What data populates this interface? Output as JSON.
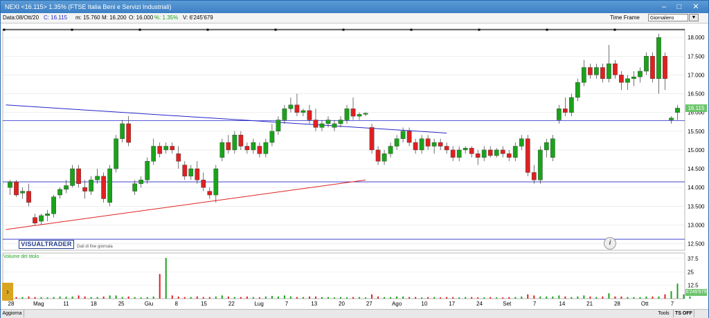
{
  "window": {
    "title": "NEXI <16.115> 1.35%  (FTSE Italia Beni e Servizi Industriali)",
    "buttons": {
      "minimize": "–",
      "maximize": "□",
      "close": "✕"
    }
  },
  "infobar": {
    "date": "Data:08/Ott/20",
    "close_label": "C: 16.115",
    "min_label": "m: 15.760",
    "max_label": "M: 16.200",
    "open_label": "O: 16.000",
    "pct_label": "%: 1.35%",
    "vol_label": "V: 6'245'679"
  },
  "timeframe": {
    "label": "Time Frame",
    "selected": "Giornaliero"
  },
  "logo": "VISUALTRADER",
  "eod_note": "Dati di fine giornata",
  "volume_title": "Volume del titolo",
  "price_badge": "16.115",
  "vol_badge": "6'245'679",
  "bottombar": {
    "update": "Aggiorna",
    "tools": "Tools",
    "ts": "TS OFF"
  },
  "colors": {
    "up": "#1aa31a",
    "down": "#e02020",
    "line_blue": "#2424c8",
    "line_red": "#e02020"
  },
  "chart_data": {
    "type": "candlestick",
    "y_ticks": [
      "18.000",
      "17.500",
      "17.000",
      "16.500",
      "16.000",
      "15.500",
      "15.000",
      "14.500",
      "14.000",
      "13.500",
      "13.000",
      "12.500"
    ],
    "y_range": [
      12.4,
      18.15
    ],
    "vol_ticks": [
      "37.5",
      "25",
      "12.5"
    ],
    "vol_range": [
      0,
      40
    ],
    "x_labels": [
      "28",
      "Mag",
      "11",
      "18",
      "25",
      "Giu",
      "8",
      "15",
      "22",
      "Lug",
      "7",
      "13",
      "20",
      "27",
      "Ago",
      "10",
      "17",
      "24",
      "Set",
      "7",
      "14",
      "21",
      "28",
      "Ott",
      "7"
    ],
    "horizontal_levels": [
      15.78,
      14.15,
      12.62
    ],
    "trendlines": [
      {
        "color": "blue",
        "from": [
          0,
          16.2
        ],
        "to": [
          70,
          15.45
        ]
      },
      {
        "color": "red",
        "from": [
          0,
          12.88
        ],
        "to": [
          57,
          14.2
        ]
      }
    ],
    "candles": [
      [
        14.0,
        14.2,
        13.8,
        14.15
      ],
      [
        14.15,
        14.2,
        13.75,
        13.8
      ],
      [
        13.85,
        14.0,
        13.7,
        13.9
      ],
      [
        13.9,
        14.1,
        13.5,
        13.6
      ],
      [
        13.2,
        13.3,
        13.0,
        13.05
      ],
      [
        13.1,
        13.3,
        13.0,
        13.25
      ],
      [
        13.25,
        13.4,
        13.1,
        13.3
      ],
      [
        13.3,
        13.8,
        13.2,
        13.75
      ],
      [
        13.8,
        14.0,
        13.7,
        13.95
      ],
      [
        13.95,
        14.2,
        13.85,
        14.05
      ],
      [
        14.05,
        14.6,
        14.0,
        14.5
      ],
      [
        14.5,
        14.6,
        14.0,
        14.1
      ],
      [
        14.0,
        14.2,
        13.7,
        13.9
      ],
      [
        13.9,
        14.3,
        13.8,
        14.2
      ],
      [
        14.2,
        14.5,
        14.1,
        14.3
      ],
      [
        14.3,
        14.4,
        13.6,
        13.7
      ],
      [
        13.6,
        14.6,
        13.5,
        14.5
      ],
      [
        14.5,
        15.4,
        14.4,
        15.3
      ],
      [
        15.3,
        15.8,
        15.2,
        15.7
      ],
      [
        15.7,
        15.9,
        15.1,
        15.2
      ],
      [
        13.9,
        14.2,
        13.8,
        14.1
      ],
      [
        14.1,
        14.3,
        14.0,
        14.2
      ],
      [
        14.2,
        14.8,
        14.1,
        14.7
      ],
      [
        14.7,
        15.3,
        14.6,
        15.1
      ],
      [
        15.1,
        15.2,
        14.8,
        14.9
      ],
      [
        15.0,
        15.2,
        14.9,
        15.1
      ],
      [
        15.1,
        15.2,
        14.9,
        15.0
      ],
      [
        14.9,
        15.1,
        14.5,
        14.7
      ],
      [
        14.6,
        14.7,
        14.2,
        14.3
      ],
      [
        14.3,
        14.6,
        14.2,
        14.5
      ],
      [
        14.5,
        14.7,
        14.1,
        14.2
      ],
      [
        14.2,
        14.4,
        13.9,
        14.0
      ],
      [
        13.9,
        14.0,
        13.7,
        13.8
      ],
      [
        13.8,
        14.6,
        13.6,
        14.5
      ],
      [
        14.8,
        15.3,
        14.7,
        15.2
      ],
      [
        15.2,
        15.4,
        14.9,
        15.0
      ],
      [
        15.0,
        15.5,
        14.9,
        15.4
      ],
      [
        15.4,
        15.5,
        15.0,
        15.1
      ],
      [
        15.1,
        15.2,
        14.9,
        15.0
      ],
      [
        15.0,
        15.3,
        14.9,
        15.2
      ],
      [
        15.1,
        15.2,
        14.8,
        14.9
      ],
      [
        14.9,
        15.3,
        14.8,
        15.2
      ],
      [
        15.2,
        15.7,
        15.1,
        15.5
      ],
      [
        15.5,
        15.9,
        15.4,
        15.8
      ],
      [
        15.8,
        16.2,
        15.7,
        16.1
      ],
      [
        16.1,
        16.4,
        16.0,
        16.2
      ],
      [
        16.2,
        16.5,
        15.9,
        16.0
      ],
      [
        16.0,
        16.1,
        15.9,
        16.05
      ],
      [
        16.05,
        16.2,
        15.7,
        15.8
      ],
      [
        15.8,
        16.1,
        15.5,
        15.6
      ],
      [
        15.6,
        15.8,
        15.5,
        15.7
      ],
      [
        15.7,
        15.9,
        15.6,
        15.8
      ],
      [
        15.6,
        15.8,
        15.5,
        15.7
      ],
      [
        15.7,
        15.9,
        15.6,
        15.8
      ],
      [
        15.8,
        16.2,
        15.7,
        16.1
      ],
      [
        16.1,
        16.4,
        15.8,
        15.9
      ],
      [
        15.9,
        16.0,
        15.8,
        15.95
      ],
      [
        15.95,
        16.0,
        15.9,
        15.98
      ],
      [
        15.6,
        15.7,
        14.9,
        15.0
      ],
      [
        15.0,
        15.1,
        14.6,
        14.7
      ],
      [
        14.7,
        15.0,
        14.6,
        14.9
      ],
      [
        14.9,
        15.2,
        14.8,
        15.1
      ],
      [
        15.1,
        15.4,
        15.0,
        15.3
      ],
      [
        15.3,
        15.6,
        15.2,
        15.5
      ],
      [
        15.5,
        15.6,
        15.1,
        15.2
      ],
      [
        15.2,
        15.3,
        14.9,
        15.0
      ],
      [
        15.0,
        15.4,
        14.9,
        15.3
      ],
      [
        15.3,
        15.4,
        15.0,
        15.1
      ],
      [
        15.1,
        15.3,
        14.9,
        15.2
      ],
      [
        15.2,
        15.3,
        15.0,
        15.1
      ],
      [
        15.1,
        15.2,
        14.9,
        15.0
      ],
      [
        15.0,
        15.1,
        14.7,
        14.8
      ],
      [
        14.8,
        15.1,
        14.7,
        15.0
      ],
      [
        15.0,
        15.1,
        14.9,
        15.05
      ],
      [
        15.05,
        15.1,
        14.8,
        14.9
      ],
      [
        14.9,
        15.0,
        14.6,
        14.8
      ],
      [
        14.8,
        15.1,
        14.7,
        15.0
      ],
      [
        15.0,
        15.1,
        14.8,
        14.85
      ],
      [
        14.85,
        15.05,
        14.8,
        15.0
      ],
      [
        15.0,
        15.1,
        14.8,
        14.9
      ],
      [
        14.9,
        15.0,
        14.7,
        14.8
      ],
      [
        14.8,
        15.2,
        14.7,
        15.1
      ],
      [
        15.1,
        15.4,
        15.0,
        15.3
      ],
      [
        15.3,
        15.4,
        14.3,
        14.4
      ],
      [
        14.4,
        14.6,
        14.1,
        14.2
      ],
      [
        14.2,
        15.1,
        14.1,
        15.0
      ],
      [
        15.0,
        15.3,
        14.8,
        15.2
      ],
      [
        14.8,
        15.4,
        14.7,
        15.3
      ],
      [
        15.8,
        16.2,
        15.7,
        16.1
      ],
      [
        16.1,
        16.4,
        15.9,
        16.0
      ],
      [
        16.0,
        16.5,
        15.9,
        16.4
      ],
      [
        16.4,
        16.9,
        16.3,
        16.8
      ],
      [
        16.8,
        17.4,
        16.7,
        17.2
      ],
      [
        17.2,
        17.3,
        16.9,
        17.0
      ],
      [
        17.0,
        17.3,
        16.9,
        17.2
      ],
      [
        17.2,
        17.3,
        16.8,
        16.9
      ],
      [
        16.9,
        17.8,
        16.8,
        17.3
      ],
      [
        17.3,
        17.4,
        16.9,
        17.0
      ],
      [
        17.0,
        17.1,
        16.6,
        16.8
      ],
      [
        16.8,
        17.0,
        16.6,
        16.9
      ],
      [
        16.9,
        17.1,
        16.7,
        16.95
      ],
      [
        16.95,
        17.2,
        16.8,
        17.1
      ],
      [
        17.1,
        17.6,
        17.0,
        17.5
      ],
      [
        17.5,
        17.6,
        16.8,
        16.9
      ],
      [
        16.9,
        18.1,
        16.5,
        18.0
      ],
      [
        17.5,
        17.6,
        16.6,
        16.9
      ],
      [
        15.8,
        15.9,
        15.7,
        15.85
      ],
      [
        16.0,
        16.2,
        15.8,
        16.115
      ]
    ],
    "volumes": [
      2,
      1.5,
      1.5,
      2,
      1.5,
      1.5,
      1.2,
      1.5,
      2,
      1.8,
      2,
      3,
      2,
      1.5,
      1.5,
      2,
      3,
      3,
      1.5,
      2,
      1.5,
      1.2,
      1.5,
      2,
      23,
      38,
      3,
      2,
      1.5,
      1.5,
      2,
      1.5,
      1.5,
      2,
      3,
      2,
      1.5,
      1.5,
      2,
      1.5,
      1.2,
      2,
      2.5,
      2,
      3,
      2,
      1.5,
      1.5,
      2,
      2,
      1.5,
      1.5,
      1.2,
      1.5,
      1.2,
      1.5,
      1.5,
      1.2,
      4,
      2,
      1.5,
      1.5,
      2,
      2,
      1.5,
      1.5,
      1.2,
      1.5,
      1.5,
      1.2,
      1.5,
      1.5,
      1.2,
      1.5,
      1.5,
      1.2,
      1.2,
      1.5,
      1.2,
      1.2,
      1.5,
      1.5,
      2,
      4,
      3,
      2,
      2,
      2,
      3,
      2,
      1.5,
      2,
      3,
      2,
      1.5,
      2,
      5,
      2,
      2,
      1.5,
      1.5,
      1.5,
      2,
      2,
      2,
      4,
      7,
      14,
      4,
      2
    ]
  }
}
